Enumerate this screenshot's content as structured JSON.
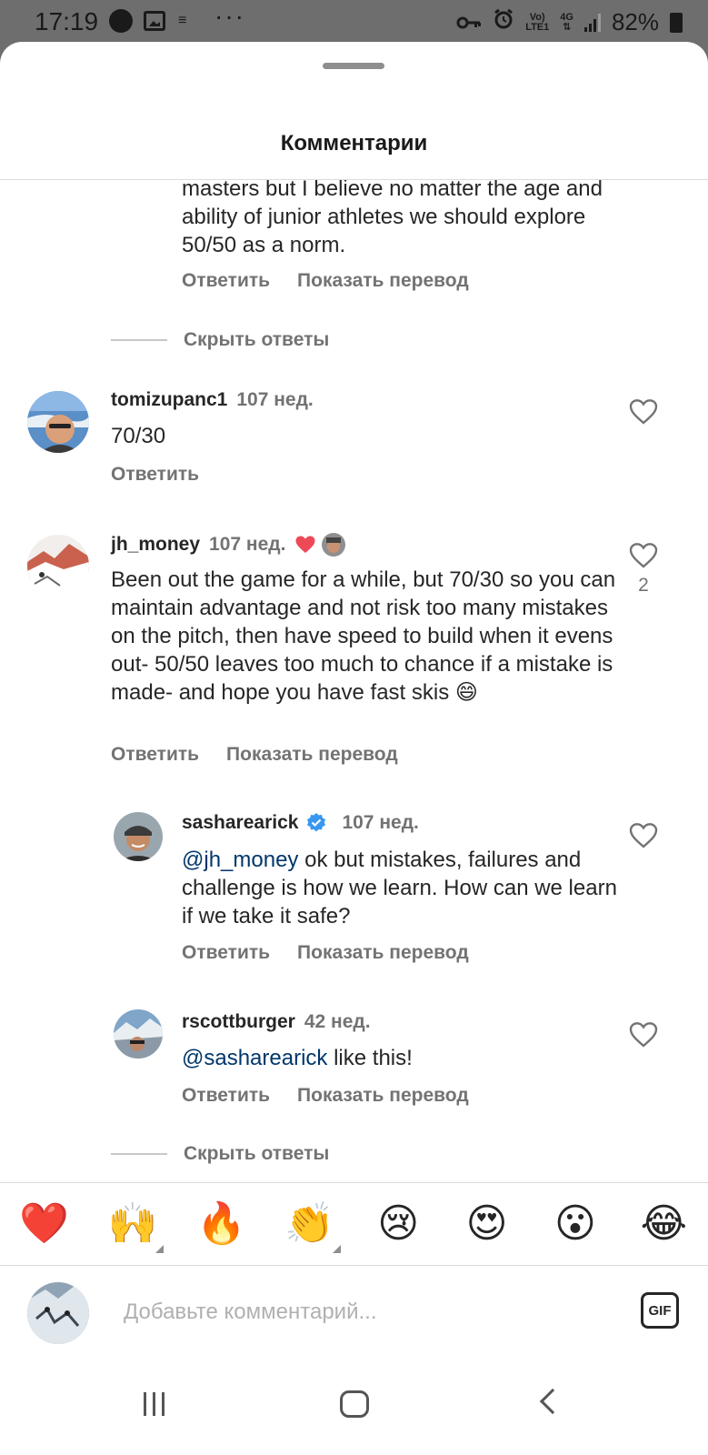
{
  "status_bar": {
    "time": "17:19",
    "more": "···",
    "network_top": "Vo)",
    "network_bottom": "LTE1",
    "gen_top": "4G",
    "gen_bottom": "⇅",
    "battery": "82%"
  },
  "sheet": {
    "title": "Комментарии"
  },
  "labels": {
    "reply": "Ответить",
    "translate": "Показать перевод",
    "hide_replies": "Скрыть ответы"
  },
  "comments": {
    "partial": {
      "text": "masters but I believe no matter the age and ability of junior athletes we should explore 50/50 as a norm."
    },
    "tomizupanc1": {
      "username": "tomizupanc1",
      "time": "107 нед.",
      "text": "70/30"
    },
    "jh_money": {
      "username": "jh_money",
      "time": "107 нед.",
      "text": "Been out the game for a while, but 70/30 so you can maintain advantage and not risk too many mistakes on the pitch, then have speed to build when it evens out- 50/50 leaves too much to chance if a mistake is made- and hope you have fast skis 😄",
      "likes": "2"
    },
    "sasharearick": {
      "username": "sasharearick",
      "time": "107 нед.",
      "mention": "@jh_money",
      "text": " ok but mistakes, failures and challenge is how we learn. How can we learn if we take it safe?"
    },
    "rscottburger": {
      "username": "rscottburger",
      "time": "42 нед.",
      "mention": "@sasharearick",
      "text": " like this!"
    }
  },
  "emoji_bar": [
    "❤️",
    "🙌",
    "🔥",
    "👏",
    "😢",
    "😍",
    "😮",
    "😂"
  ],
  "input": {
    "placeholder": "Добавьте комментарий...",
    "gif_label": "GIF"
  },
  "colors": {
    "like_red": "#ed4956",
    "mention_blue": "#00376b",
    "verified_blue": "#3897f0",
    "muted_text": "#737373"
  }
}
